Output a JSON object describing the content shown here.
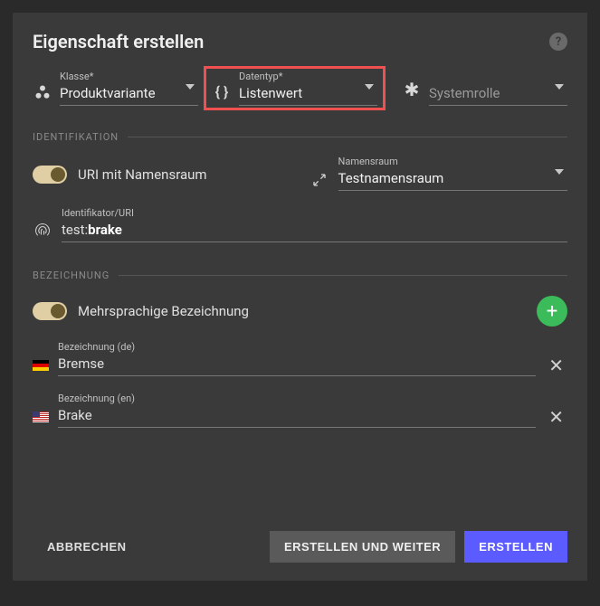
{
  "title": "Eigenschaft erstellen",
  "selects": {
    "class": {
      "label": "Klasse*",
      "value": "Produktvariante"
    },
    "datatype": {
      "label": "Datentyp*",
      "value": "Listenwert"
    },
    "systemrole": {
      "label": "",
      "value": "Systemrolle"
    }
  },
  "sections": {
    "identification": "IDENTIFIKATION",
    "designation": "BEZEICHNUNG"
  },
  "uriToggle": {
    "label": "URI mit Namensraum"
  },
  "namespace": {
    "label": "Namensraum",
    "value": "Testnamensraum"
  },
  "identifier": {
    "label": "Identifikator/URI",
    "prefix": "test:",
    "value": "brake"
  },
  "multilangToggle": {
    "label": "Mehrsprachige Bezeichnung"
  },
  "designations": {
    "de": {
      "label": "Bezeichnung (de)",
      "value": "Bremse"
    },
    "en": {
      "label": "Bezeichnung (en)",
      "value": "Brake"
    }
  },
  "buttons": {
    "cancel": "ABBRECHEN",
    "createContinue": "ERSTELLEN UND WEITER",
    "create": "ERSTELLEN"
  }
}
